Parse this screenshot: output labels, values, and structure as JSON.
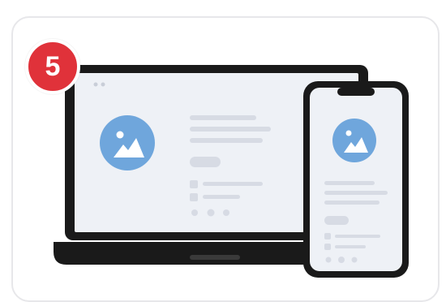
{
  "badge": {
    "number": "5",
    "color": "#e0323a"
  },
  "colors": {
    "device_frame": "#1a1a1a",
    "screen_bg": "#eef1f6",
    "placeholder_lines": "#d7dbe4",
    "avatar_circle": "#6fa6dc",
    "card_border": "#e7e7ea"
  },
  "icons": {
    "laptop_avatar": "image-icon",
    "phone_avatar": "image-icon",
    "social": [
      "twitter-icon",
      "chat-icon",
      "github-icon"
    ]
  }
}
